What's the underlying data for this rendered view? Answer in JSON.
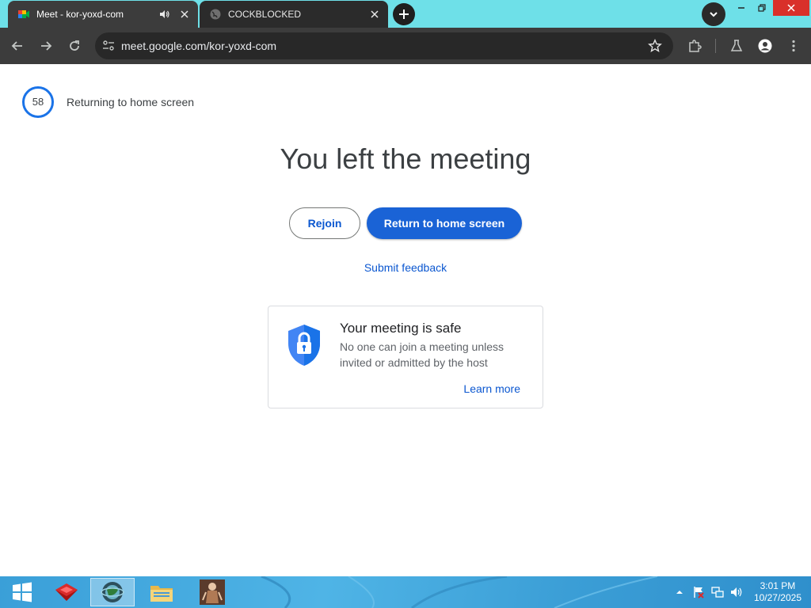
{
  "browser": {
    "tabs": [
      {
        "title": "Meet - kor-yoxd-com",
        "active": true,
        "audio": true
      },
      {
        "title": "COCKBLOCKED",
        "active": false,
        "audio": false
      }
    ],
    "url": "meet.google.com/kor-yoxd-com"
  },
  "page": {
    "countdown": "58",
    "returning_text": "Returning to home screen",
    "headline": "You left the meeting",
    "rejoin_label": "Rejoin",
    "home_label": "Return to home screen",
    "feedback_label": "Submit feedback",
    "safe_card": {
      "title": "Your meeting is safe",
      "description": "No one can join a meeting unless invited or admitted by the host",
      "learn_more": "Learn more"
    }
  },
  "taskbar": {
    "time": "3:01 PM",
    "date": "10/27/2025"
  },
  "colors": {
    "accent_blue": "#0b57d0",
    "primary_button": "#1a63d6",
    "tabstrip": "#6ee0e8",
    "toolbar": "#3c3c3c"
  }
}
